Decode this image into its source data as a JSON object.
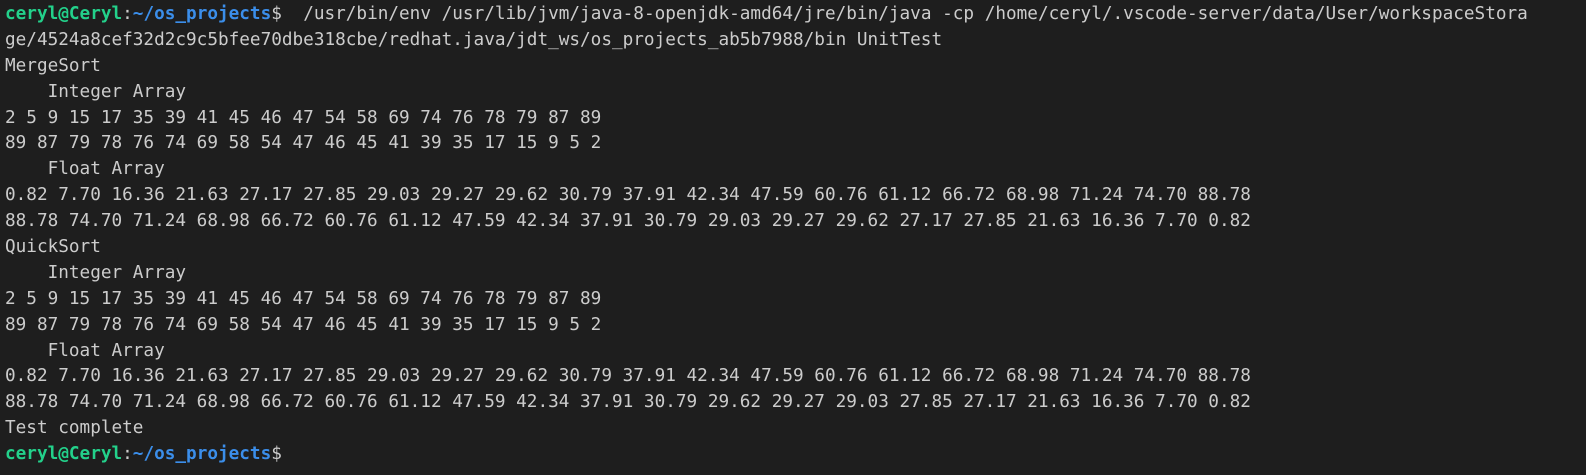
{
  "colors": {
    "background": "#1e1e1e",
    "foreground": "#cccccc",
    "prompt_user": "#23d18b",
    "prompt_path": "#3b8eea"
  },
  "prompt": {
    "user_host": "ceryl@Ceryl",
    "separator": ":",
    "path": "~/os_projects",
    "symbol": "$"
  },
  "command": {
    "line1": "  /usr/bin/env /usr/lib/jvm/java-8-openjdk-amd64/jre/bin/java -cp /home/ceryl/.vscode-server/data/User/workspaceStora",
    "line2": "ge/4524a8cef32d2c9c5bfee70dbe318cbe/redhat.java/jdt_ws/os_projects_ab5b7988/bin UnitTest"
  },
  "output": [
    "MergeSort",
    "    Integer Array",
    "2 5 9 15 17 35 39 41 45 46 47 54 58 69 74 76 78 79 87 89",
    "89 87 79 78 76 74 69 58 54 47 46 45 41 39 35 17 15 9 5 2",
    "    Float Array",
    "0.82 7.70 16.36 21.63 27.17 27.85 29.03 29.27 29.62 30.79 37.91 42.34 47.59 60.76 61.12 66.72 68.98 71.24 74.70 88.78",
    "88.78 74.70 71.24 68.98 66.72 60.76 61.12 47.59 42.34 37.91 30.79 29.03 29.27 29.62 27.17 27.85 21.63 16.36 7.70 0.82",
    "QuickSort",
    "    Integer Array",
    "2 5 9 15 17 35 39 41 45 46 47 54 58 69 74 76 78 79 87 89",
    "89 87 79 78 76 74 69 58 54 47 46 45 41 39 35 17 15 9 5 2",
    "    Float Array",
    "0.82 7.70 16.36 21.63 27.17 27.85 29.03 29.27 29.62 30.79 37.91 42.34 47.59 60.76 61.12 66.72 68.98 71.24 74.70 88.78",
    "88.78 74.70 71.24 68.98 66.72 60.76 61.12 47.59 42.34 37.91 30.79 29.62 29.27 29.03 27.85 27.17 21.63 16.36 7.70 0.82",
    "Test complete"
  ]
}
